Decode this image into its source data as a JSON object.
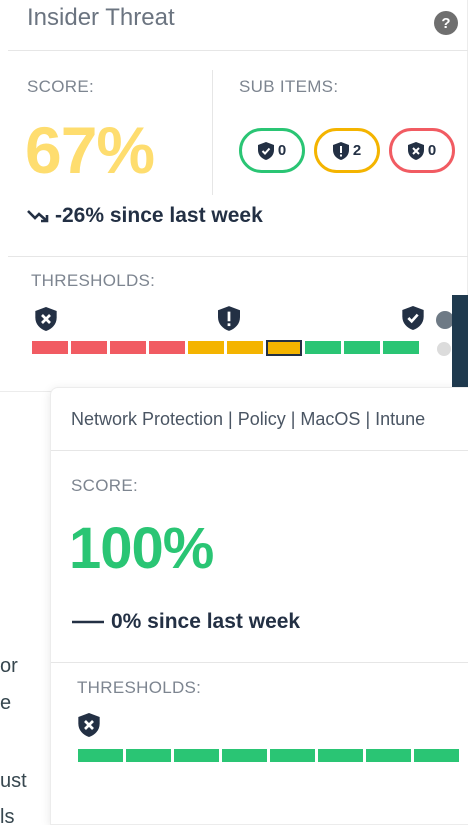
{
  "card1": {
    "title": "Insider Threat",
    "help_glyph": "?",
    "score_label": "SCORE:",
    "score_value": "67%",
    "subitems_label": "SUB ITEMS:",
    "subitems": [
      {
        "icon": "shield-check-icon",
        "count": "0",
        "color": "#2ac574"
      },
      {
        "icon": "shield-alert-icon",
        "count": "2",
        "color": "#f4b400"
      },
      {
        "icon": "shield-x-icon",
        "count": "0",
        "color": "#f15b62"
      }
    ],
    "trend_icon": "trend-down-icon",
    "trend_text": "-26% since last week",
    "thresholds_label": "THRESHOLDS:",
    "threshold_colors": {
      "red": "#f15b62",
      "yellow": "#f4b400",
      "green": "#2ac574"
    },
    "score_color": "#fedd6f"
  },
  "card2": {
    "title": "Network Protection | Policy | MacOS | Intune",
    "score_label": "SCORE:",
    "score_value": "100%",
    "trend_icon": "trend-flat-icon",
    "trend_text": "0% since last week",
    "thresholds_label": "THRESHOLDS:",
    "score_color": "#2ac574"
  },
  "background_text": {
    "line1": "or",
    "line2": "e",
    "line3": "ust",
    "line4": "ls"
  }
}
